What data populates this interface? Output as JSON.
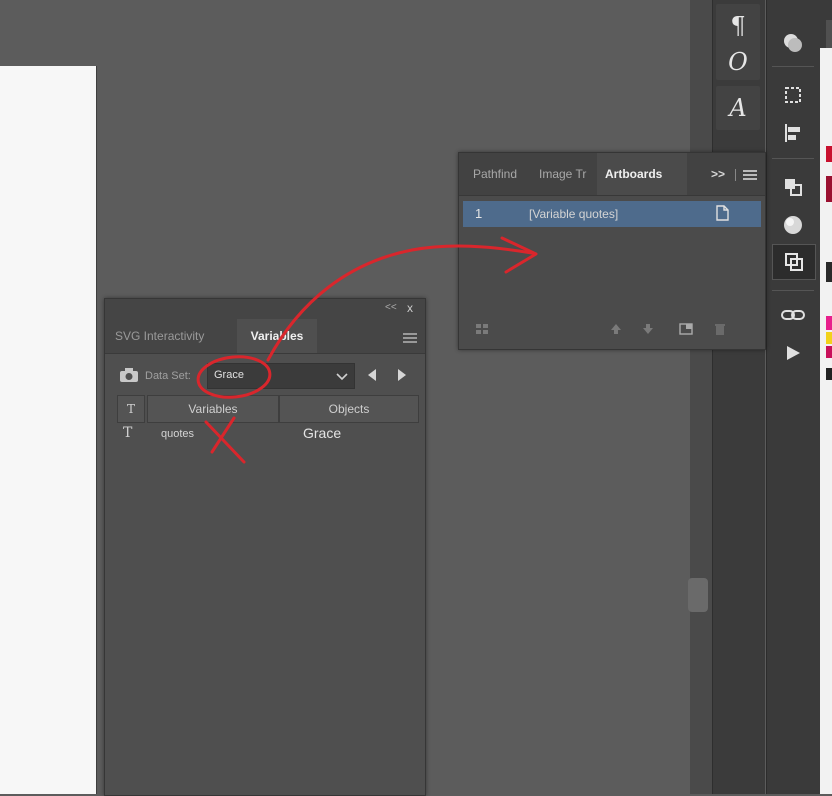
{
  "artboards_panel": {
    "tabs": [
      "Pathfind",
      "Image Tr",
      "Artboards"
    ],
    "active_tab": "Artboards",
    "overflow_icon": ">>",
    "menu_icon": "panel-menu-icon",
    "artboard_rows": [
      {
        "number": "1",
        "name": "[Variable quotes]"
      }
    ]
  },
  "variables_panel": {
    "tabs": [
      "SVG Interactivity",
      "Variables"
    ],
    "active_tab": "Variables",
    "collapse_icon": "<<",
    "close_icon": "x",
    "data_set_label": "Data Set:",
    "data_set_value": "Grace",
    "columns": [
      "Variables",
      "Objects"
    ],
    "rows": [
      {
        "type_icon": "T",
        "variable": "quotes",
        "object": "Grace"
      }
    ]
  },
  "dock_icons": [
    "pilcrow-icon",
    "opentype-icon",
    "character-styles-icon"
  ],
  "tool_icons": [
    "shape-icon",
    "transform-icon",
    "align-icon",
    "pathfinder-icon",
    "appearance-icon",
    "artboards-icon",
    "links-icon",
    "actions-play-icon"
  ],
  "annotation": {
    "color": "#d9262c"
  },
  "colors": {
    "canvas": "#5c5c5c",
    "panel": "#4f4f4f",
    "selected_row": "#4e6b8c"
  }
}
